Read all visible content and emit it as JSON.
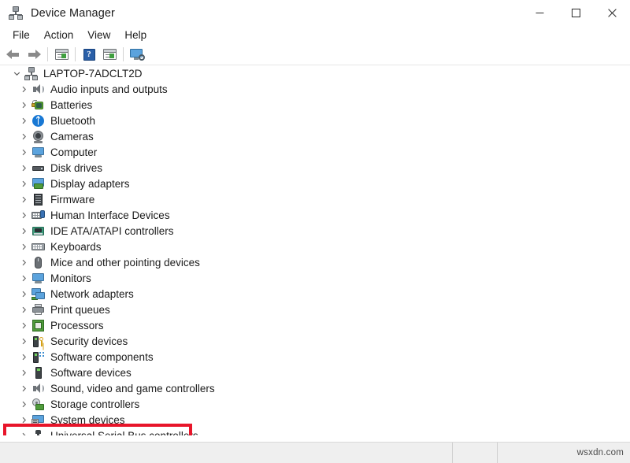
{
  "window": {
    "title": "Device Manager",
    "icon": "device-tree-icon",
    "controls": {
      "minimize": "–",
      "maximize": "□",
      "close": "✕"
    }
  },
  "menubar": {
    "items": [
      {
        "label": "File"
      },
      {
        "label": "Action"
      },
      {
        "label": "View"
      },
      {
        "label": "Help"
      }
    ]
  },
  "toolbar": {
    "buttons": [
      {
        "icon": "back-arrow-icon",
        "name": "back-button"
      },
      {
        "icon": "forward-arrow-icon",
        "name": "forward-button"
      },
      {
        "icon": "properties-panel-icon",
        "name": "properties-button"
      },
      {
        "icon": "help-question-icon",
        "name": "help-button"
      },
      {
        "icon": "scan-panel-icon",
        "name": "scan-for-hardware-changes-button"
      },
      {
        "icon": "monitor-search-icon",
        "name": "show-hidden-devices-button"
      }
    ]
  },
  "tree": {
    "root": {
      "label": "LAPTOP-7ADCLT2D",
      "icon": "computer-tree-icon",
      "expanded": true
    },
    "nodes": [
      {
        "label": "Audio inputs and outputs",
        "icon": "speaker-icon"
      },
      {
        "label": "Batteries",
        "icon": "battery-icon"
      },
      {
        "label": "Bluetooth",
        "icon": "bluetooth-icon"
      },
      {
        "label": "Cameras",
        "icon": "camera-icon"
      },
      {
        "label": "Computer",
        "icon": "monitor-icon"
      },
      {
        "label": "Disk drives",
        "icon": "disk-drive-icon"
      },
      {
        "label": "Display adapters",
        "icon": "display-adapter-icon"
      },
      {
        "label": "Firmware",
        "icon": "firmware-icon"
      },
      {
        "label": "Human Interface Devices",
        "icon": "hid-icon"
      },
      {
        "label": "IDE ATA/ATAPI controllers",
        "icon": "ide-controller-icon"
      },
      {
        "label": "Keyboards",
        "icon": "keyboard-icon"
      },
      {
        "label": "Mice and other pointing devices",
        "icon": "mouse-icon"
      },
      {
        "label": "Monitors",
        "icon": "monitor-icon"
      },
      {
        "label": "Network adapters",
        "icon": "network-adapter-icon"
      },
      {
        "label": "Print queues",
        "icon": "printer-icon"
      },
      {
        "label": "Processors",
        "icon": "processor-icon"
      },
      {
        "label": "Security devices",
        "icon": "security-device-icon"
      },
      {
        "label": "Software components",
        "icon": "software-component-icon"
      },
      {
        "label": "Software devices",
        "icon": "software-device-icon"
      },
      {
        "label": "Sound, video and game controllers",
        "icon": "speaker-icon"
      },
      {
        "label": "Storage controllers",
        "icon": "storage-controller-icon"
      },
      {
        "label": "System devices",
        "icon": "system-device-icon"
      },
      {
        "label": "Universal Serial Bus controllers",
        "icon": "usb-icon"
      }
    ]
  },
  "annotation": {
    "type": "highlight-rectangle",
    "color": "#e8152a",
    "target_label": "Universal Serial Bus controllers"
  },
  "statusbar": {
    "main": "",
    "mid": "",
    "watermark": "wsxdn.com"
  }
}
